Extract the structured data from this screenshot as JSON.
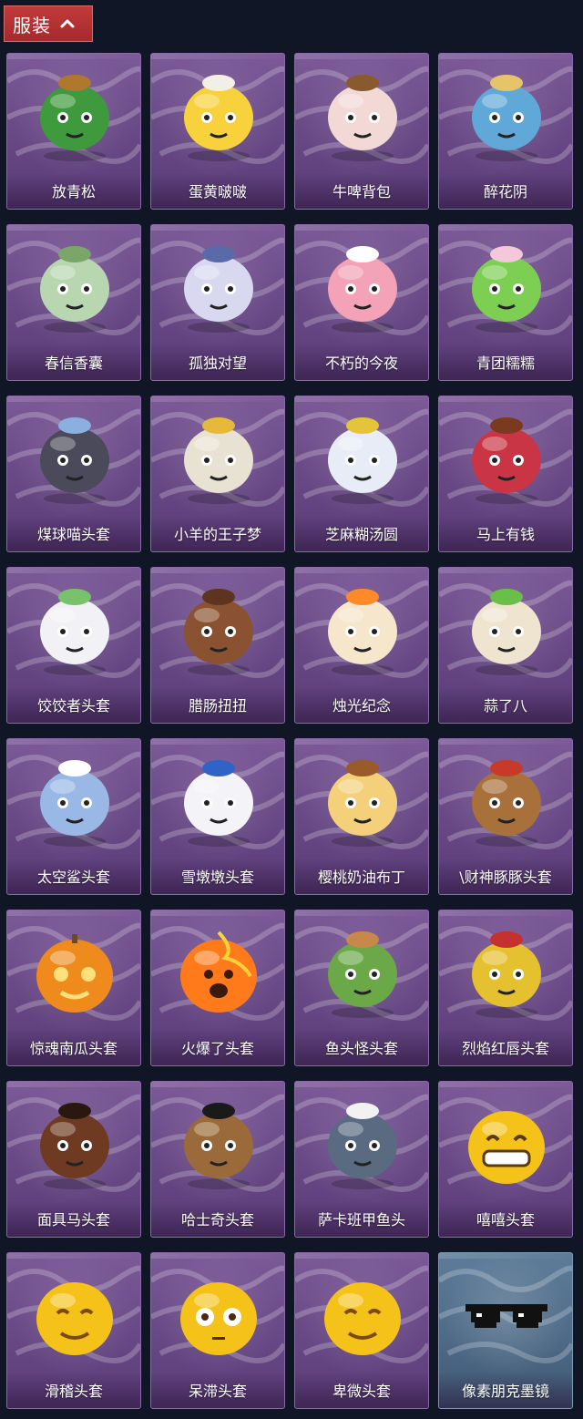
{
  "header": {
    "tab_label": "服装",
    "tab_icon": "chevron-up-icon",
    "tab_color": "#a52a2d"
  },
  "items": [
    {
      "label": "放青松",
      "icon": "bonsai-icon"
    },
    {
      "label": "蛋黄啵啵",
      "icon": "chick-egg-icon"
    },
    {
      "label": "牛啤背包",
      "icon": "cow-beer-mug-icon"
    },
    {
      "label": "醉花阴",
      "icon": "dreamcatcher-icon"
    },
    {
      "label": "春信香囊",
      "icon": "sachet-icon"
    },
    {
      "label": "孤独对望",
      "icon": "doll-charm-icon"
    },
    {
      "label": "不朽的今夜",
      "icon": "pink-fox-dessert-icon"
    },
    {
      "label": "青团糯糯",
      "icon": "green-dumpling-icon"
    },
    {
      "label": "煤球喵头套",
      "icon": "black-cat-head-icon"
    },
    {
      "label": "小羊的王子梦",
      "icon": "sheep-crown-icon"
    },
    {
      "label": "芝麻糊汤圆",
      "icon": "rice-ball-icon"
    },
    {
      "label": "马上有钱",
      "icon": "red-horse-head-icon"
    },
    {
      "label": "饺饺者头套",
      "icon": "dumpling-head-icon"
    },
    {
      "label": "腊肠扭扭",
      "icon": "dachshund-head-icon"
    },
    {
      "label": "烛光纪念",
      "icon": "candle-head-icon"
    },
    {
      "label": "蒜了八",
      "icon": "garlic-head-icon"
    },
    {
      "label": "太空鲨头套",
      "icon": "shark-head-icon"
    },
    {
      "label": "雪墩墩头套",
      "icon": "snowman-head-icon"
    },
    {
      "label": "樱桃奶油布丁",
      "icon": "pudding-head-icon"
    },
    {
      "label": "\\财神豚豚头套",
      "icon": "capybara-head-icon"
    },
    {
      "label": "惊魂南瓜头套",
      "icon": "pumpkin-head-icon"
    },
    {
      "label": "火爆了头套",
      "icon": "fire-head-icon"
    },
    {
      "label": "鱼头怪头套",
      "icon": "fish-head-icon"
    },
    {
      "label": "烈焰红唇头套",
      "icon": "yellow-mask-icon"
    },
    {
      "label": "面具马头套",
      "icon": "horse-mask-icon"
    },
    {
      "label": "哈士奇头套",
      "icon": "husky-sunglasses-icon"
    },
    {
      "label": "萨卡班甲鱼头",
      "icon": "sacabambaspis-icon"
    },
    {
      "label": "嘻嘻头套",
      "icon": "grin-emoji-icon"
    },
    {
      "label": "滑稽头套",
      "icon": "smirk-emoji-icon"
    },
    {
      "label": "呆滞头套",
      "icon": "stare-emoji-icon"
    },
    {
      "label": "卑微头套",
      "icon": "pleading-emoji-icon"
    },
    {
      "label": "像素朋克墨镜",
      "icon": "pixel-sunglasses-icon"
    }
  ]
}
